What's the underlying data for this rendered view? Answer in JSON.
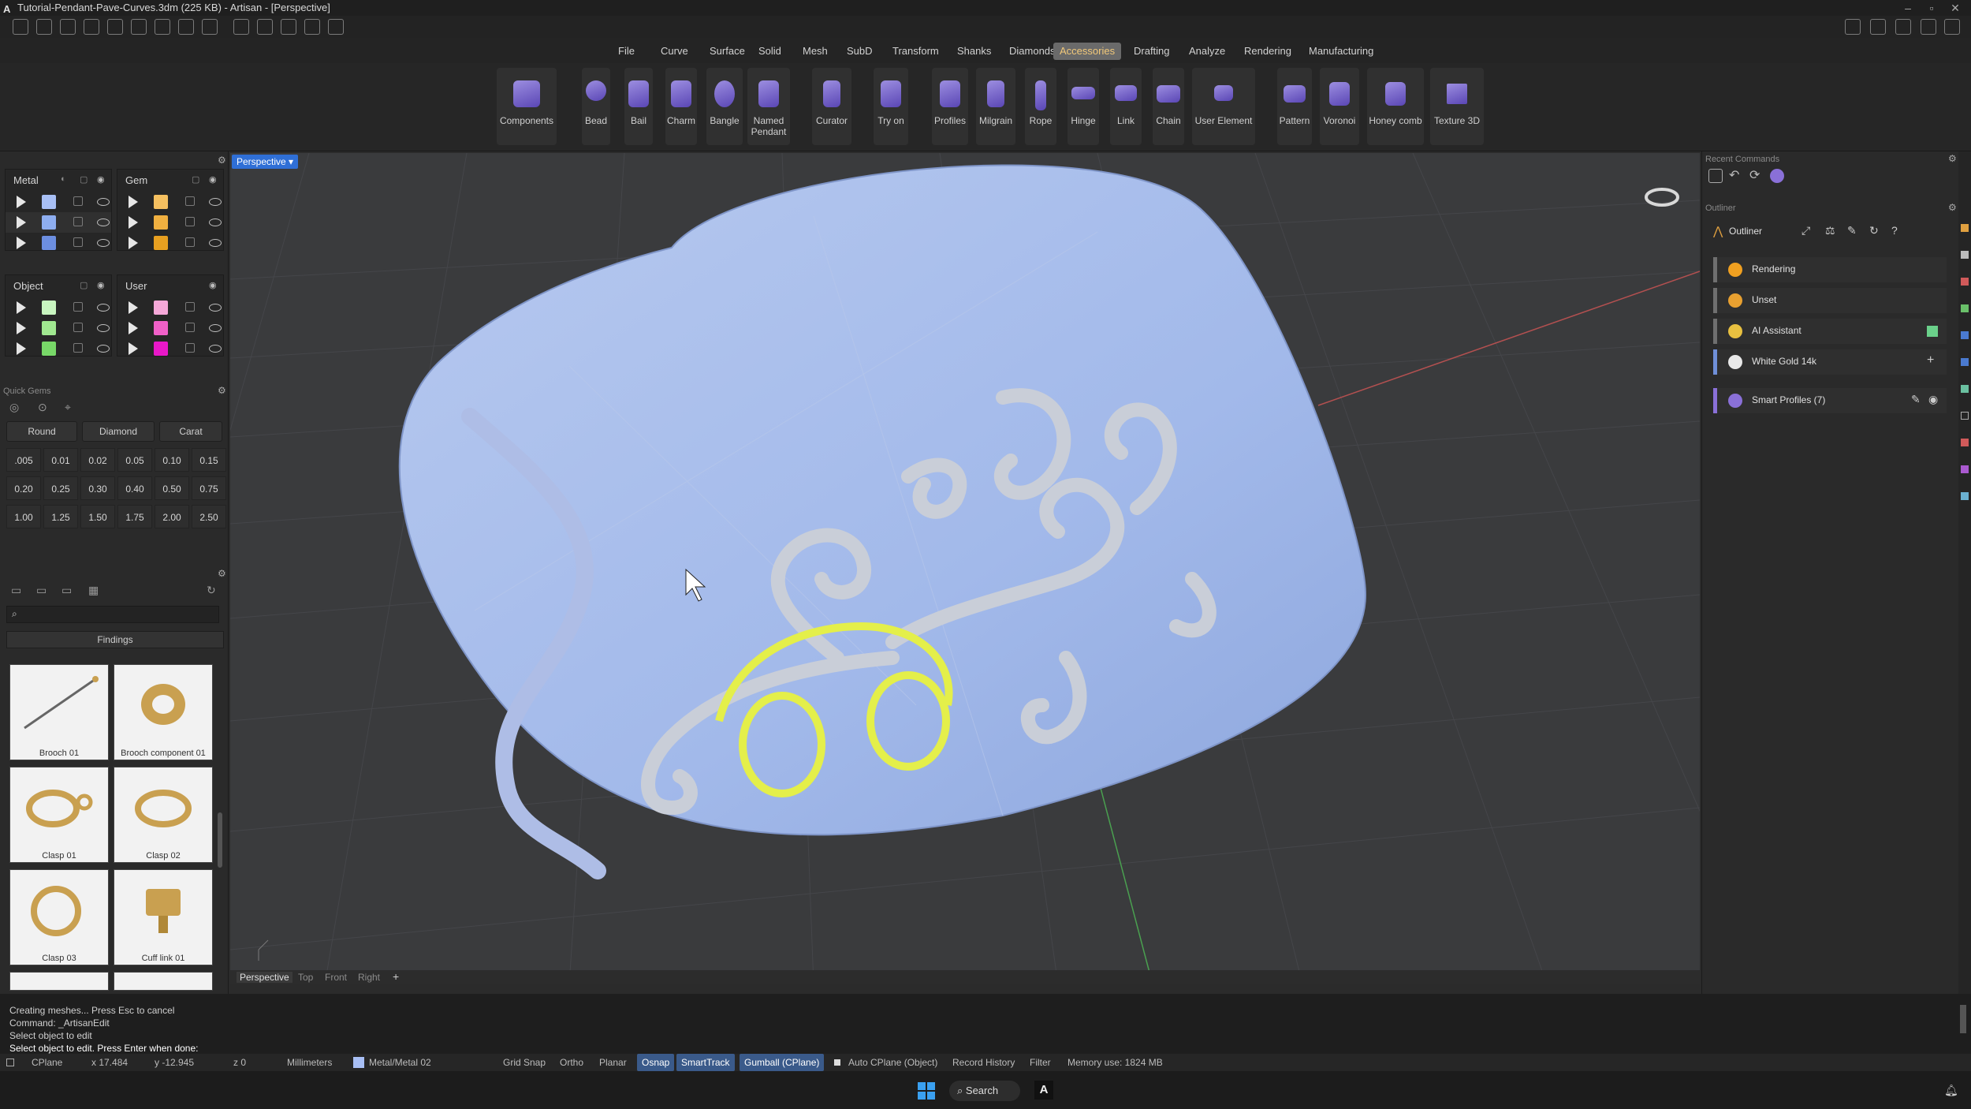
{
  "window": {
    "title": "Tutorial-Pendant-Pave-Curves.3dm (225 KB) - Artisan - [Perspective]"
  },
  "menu": [
    "File",
    "Curve",
    "Surface",
    "Solid",
    "Mesh",
    "SubD",
    "Transform",
    "Shanks",
    "Diamonds",
    "Accessories",
    "Drafting",
    "Analyze",
    "Rendering",
    "Manufacturing"
  ],
  "menu_active": "Accessories",
  "ribbon": [
    {
      "label": "Components"
    },
    {
      "label": "Bead"
    },
    {
      "label": "Bail"
    },
    {
      "label": "Charm"
    },
    {
      "label": "Bangle"
    },
    {
      "label": "Named Pendant"
    },
    {
      "label": "Curator"
    },
    {
      "label": "Try on"
    },
    {
      "label": "Profiles"
    },
    {
      "label": "Milgrain"
    },
    {
      "label": "Rope"
    },
    {
      "label": "Hinge"
    },
    {
      "label": "Link"
    },
    {
      "label": "Chain"
    },
    {
      "label": "User Element"
    },
    {
      "label": "Pattern"
    },
    {
      "label": "Voronoi"
    },
    {
      "label": "Honey comb"
    },
    {
      "label": "Texture 3D"
    }
  ],
  "layers": {
    "metal": {
      "title": "Metal",
      "colors": [
        "#a8bff5",
        "#8eaef0",
        "#6c8ee0"
      ]
    },
    "gem": {
      "title": "Gem",
      "colors": [
        "#f5c060",
        "#f0b040",
        "#e8a020"
      ]
    },
    "object": {
      "title": "Object",
      "colors": [
        "#c8f5c0",
        "#a0e890",
        "#78d868"
      ]
    },
    "user": {
      "title": "User",
      "colors": [
        "#f5a8d8",
        "#f060c8",
        "#e818c8"
      ]
    }
  },
  "quick_gems": {
    "label": "Quick Gems",
    "shape": "Round",
    "material": "Diamond",
    "unit": "Carat",
    "sizes": [
      ".005",
      "0.01",
      "0.02",
      "0.05",
      "0.10",
      "0.15",
      "0.20",
      "0.25",
      "0.30",
      "0.40",
      "0.50",
      "0.75",
      "1.00",
      "1.25",
      "1.50",
      "1.75",
      "2.00",
      "2.50"
    ]
  },
  "library": {
    "category": "Findings",
    "items": [
      "Brooch 01",
      "Brooch component 01",
      "Clasp 01",
      "Clasp 02",
      "Clasp 03",
      "Cuff link 01"
    ]
  },
  "viewport": {
    "active_label": "Perspective",
    "tabs": [
      "Perspective",
      "Top",
      "Front",
      "Right"
    ],
    "add_tab": "+"
  },
  "right_panel": {
    "recent_label": "Recent Commands",
    "outliner_label": "Outliner",
    "outliner_title": "Outliner",
    "rows": [
      {
        "label": "Rendering",
        "color": "#f0a020"
      },
      {
        "label": "Unset",
        "color": "#e8a030"
      },
      {
        "label": "AI Assistant",
        "color": "#e8c040"
      },
      {
        "label": "White Gold 14k",
        "color": "#e8e8e8"
      },
      {
        "label": "Smart Profiles (7)",
        "color": "#8a70d8"
      }
    ]
  },
  "command": {
    "lines": [
      "Creating meshes... Press Esc to cancel",
      "Command: _ArtisanEdit",
      "Select object to edit"
    ],
    "prompt": "Select object to edit. Press Enter when done:"
  },
  "status": {
    "cplane": "CPlane",
    "x": "x 17.484",
    "y": "y -12.945",
    "z": "z 0",
    "units": "Millimeters",
    "layer": "Metal/Metal 02",
    "grid_snap": "Grid Snap",
    "ortho": "Ortho",
    "planar": "Planar",
    "osnap": "Osnap",
    "smarttrack": "SmartTrack",
    "gumball": "Gumball (CPlane)",
    "auto_cplane": "Auto CPlane (Object)",
    "record_history": "Record History",
    "filter": "Filter",
    "memory": "Memory use: 1824 MB"
  },
  "taskbar": {
    "search": "Search"
  }
}
